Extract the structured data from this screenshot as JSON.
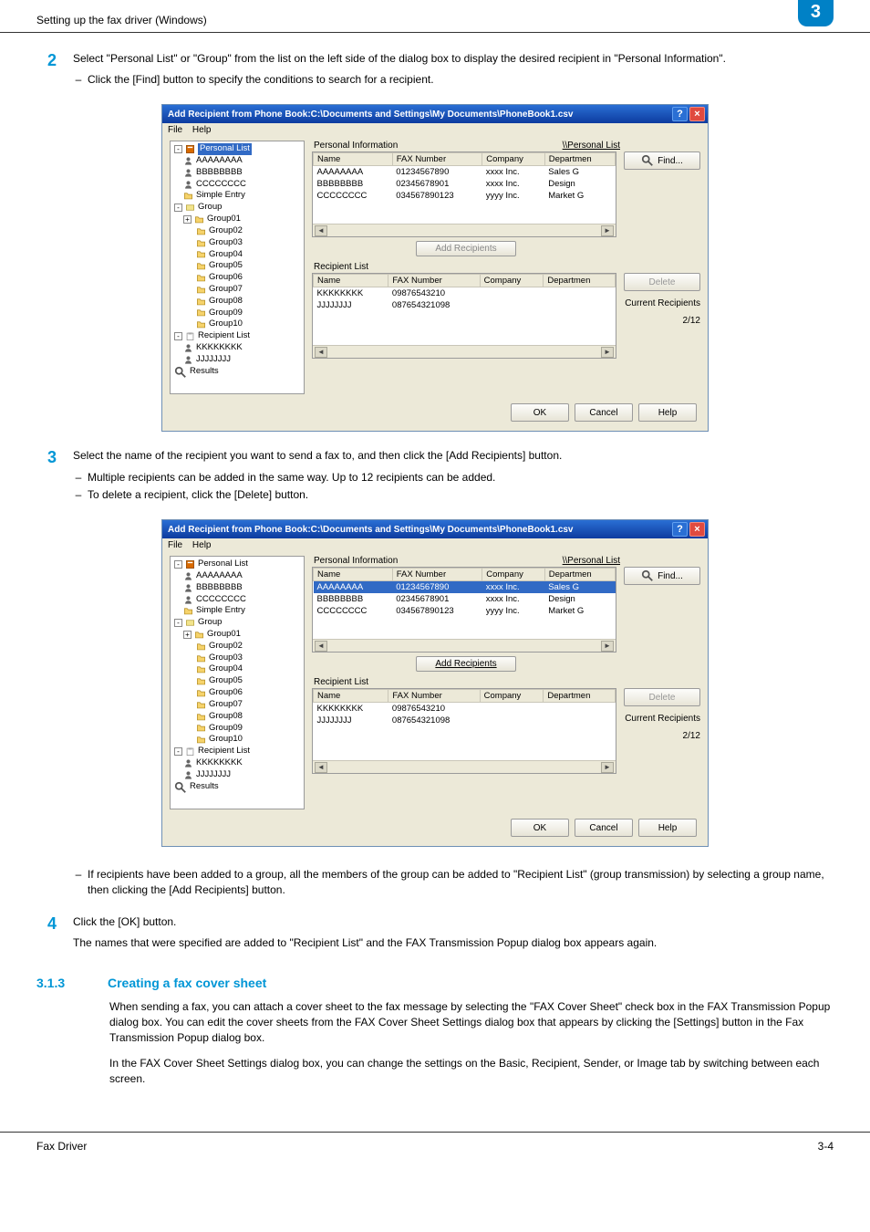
{
  "page": {
    "running_head": "Setting up the fax driver (Windows)",
    "chapter_badge": "3"
  },
  "step2": {
    "num": "2",
    "text": "Select \"Personal List\" or \"Group\" from the list on the left side of the dialog box to display the desired recipient in \"Personal Information\".",
    "bullets": [
      "Click the [Find] button to specify the conditions to search for a recipient."
    ]
  },
  "step3": {
    "num": "3",
    "text": "Select the name of the recipient you want to send a fax to, and then click the [Add Recipients] button.",
    "bullets": [
      "Multiple recipients can be added in the same way. Up to 12 recipients can be added.",
      "To delete a recipient, click the [Delete] button."
    ],
    "after_bullets": [
      "If recipients have been added to a group, all the members of the group can be added to \"Recipient List\" (group transmission) by selecting a group name, then clicking the [Add Recipients] button."
    ]
  },
  "step4": {
    "num": "4",
    "text": "Click the [OK] button.",
    "after": "The names that were specified are added to \"Recipient List\" and the FAX Transmission Popup dialog box appears again."
  },
  "section_313": {
    "num": "3.1.3",
    "title": "Creating a fax cover sheet",
    "para1": "When sending a fax, you can attach a cover sheet to the fax message by selecting the \"FAX Cover Sheet\" check box in the FAX Transmission Popup dialog box. You can edit the cover sheets from the FAX Cover Sheet Settings dialog box that appears by clicking the [Settings] button in the Fax Transmission Popup dialog box.",
    "para2": "In the FAX Cover Sheet Settings dialog box, you can change the settings on the Basic, Recipient, Sender, or Image tab by switching between each screen."
  },
  "dialog": {
    "window_title": "Add Recipient from Phone Book:C:\\Documents and Settings\\My Documents\\PhoneBook1.csv",
    "menus": [
      "File",
      "Help"
    ],
    "tree_root_personal": "Personal List",
    "tree_personal_children": [
      "AAAAAAAA",
      "BBBBBBBB",
      "CCCCCCCC",
      "Simple Entry"
    ],
    "tree_root_group": "Group",
    "tree_group_children": [
      "Group01",
      "Group02",
      "Group03",
      "Group04",
      "Group05",
      "Group06",
      "Group07",
      "Group08",
      "Group09",
      "Group10"
    ],
    "tree_root_recipient": "Recipient List",
    "tree_recipient_children": [
      "KKKKKKKK",
      "JJJJJJJJ"
    ],
    "tree_results": "Results",
    "label_personal_info": "Personal Information",
    "label_personal_link": "\\\\Personal List",
    "find": "Find...",
    "columns": [
      "Name",
      "FAX Number",
      "Company",
      "Departmen"
    ],
    "personal_rows": [
      {
        "name": "AAAAAAAA",
        "fax": "01234567890",
        "company": "xxxx Inc.",
        "dept": "Sales G"
      },
      {
        "name": "BBBBBBBB",
        "fax": "02345678901",
        "company": "xxxx Inc.",
        "dept": "Design"
      },
      {
        "name": "CCCCCCCC",
        "fax": "034567890123",
        "company": "yyyy Inc.",
        "dept": "Market G"
      }
    ],
    "add_recipients": "Add Recipients",
    "label_recipient_list": "Recipient List",
    "recipient_rows": [
      {
        "name": "KKKKKKKK",
        "fax": "09876543210",
        "company": "",
        "dept": ""
      },
      {
        "name": "JJJJJJJJ",
        "fax": "087654321098",
        "company": "",
        "dept": ""
      }
    ],
    "delete": "Delete",
    "current_recipients": "Current Recipients",
    "count": "2/12",
    "ok": "OK",
    "cancel": "Cancel",
    "help": "Help"
  },
  "footer": {
    "left": "Fax Driver",
    "right": "3-4"
  }
}
